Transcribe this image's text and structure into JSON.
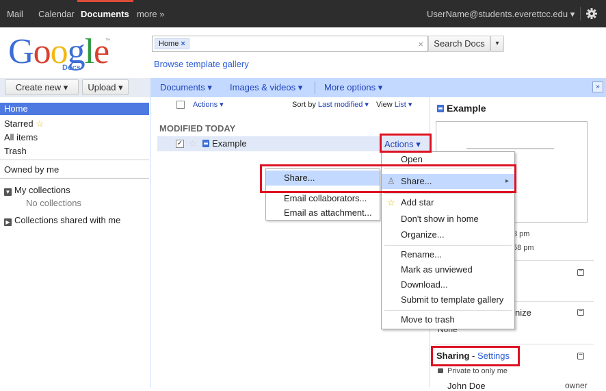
{
  "topnav": {
    "mail": "Mail",
    "calendar": "Calendar",
    "documents": "Documents",
    "more": "more »",
    "user": "UserName@students.everettcc.edu",
    "user_caret": "▾",
    "gear": "gear-icon"
  },
  "logo": {
    "word": "Google",
    "docs": "Docs",
    "tm": "™"
  },
  "search": {
    "chip": "Home",
    "chip_x": "×",
    "clear": "×",
    "button": "Search Docs",
    "dropdown": "▾"
  },
  "browse_link": "Browse template gallery",
  "left_toolbar": {
    "create": "Create new ▾",
    "upload": "Upload ▾"
  },
  "main_toolbar": {
    "documents": "Documents ▾",
    "images": "Images & videos ▾",
    "more_options": "More options ▾",
    "expand": "»"
  },
  "sidebar": {
    "home": "Home",
    "starred": "Starred",
    "all": "All items",
    "trash": "Trash",
    "owned": "Owned by me",
    "my_collections": "My collections",
    "no_collections": "No collections",
    "shared_collections": "Collections shared with me"
  },
  "list": {
    "actions": "Actions ▾",
    "sort_prefix": "Sort by",
    "sort_value": "Last modified ▾",
    "view_prefix": "View",
    "view_value": "List ▾",
    "section": "MODIFIED TODAY",
    "row": {
      "name": "Example",
      "actions": "Actions ▾",
      "checked": "✓"
    }
  },
  "actions_menu": {
    "open": "Open",
    "share": "Share...",
    "share_arrow": "▸",
    "add_star": "Add star",
    "dont_show": "Don't show in home",
    "organize": "Organize...",
    "rename": "Rename...",
    "mark_unviewed": "Mark as unviewed",
    "download": "Download...",
    "submit": "Submit to template gallery",
    "move_trash": "Move to trash"
  },
  "share_submenu": {
    "share": "Share...",
    "email_collab": "Email collaborators...",
    "email_attach": "Email as attachment..."
  },
  "right_panel": {
    "title": "Example",
    "time1": "8 pm",
    "time2": "58 pm",
    "organize_partial": "nize",
    "none_partial": "None",
    "sharing": "Sharing",
    "dash": " - ",
    "settings": "Settings",
    "private": "Private to only me",
    "owner_name": "John Doe",
    "owner_role": "owner",
    "collapse": "−"
  },
  "colors": {
    "accent": "#dd1122",
    "link": "#2a5bd7",
    "selected": "#4d79e0"
  }
}
